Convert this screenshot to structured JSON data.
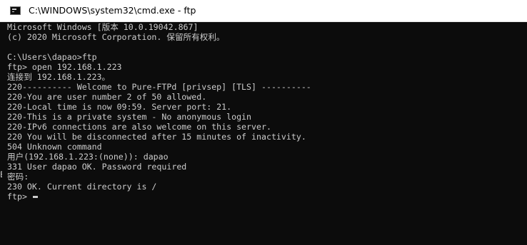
{
  "window": {
    "title": "C:\\WINDOWS\\system32\\cmd.exe - ftp",
    "icon": "cmd-icon"
  },
  "console": {
    "lines": [
      "Microsoft Windows [版本 10.0.19042.867]",
      "(c) 2020 Microsoft Corporation. 保留所有权利。",
      "",
      "C:\\Users\\dapao>ftp",
      "ftp> open 192.168.1.223",
      "连接到 192.168.1.223。",
      "220---------- Welcome to Pure-FTPd [privsep] [TLS] ----------",
      "220-You are user number 2 of 50 allowed.",
      "220-Local time is now 09:59. Server port: 21.",
      "220-This is a private system - No anonymous login",
      "220-IPv6 connections are also welcome on this server.",
      "220 You will be disconnected after 15 minutes of inactivity.",
      "504 Unknown command",
      "用户(192.168.1.223:(none)): dapao",
      "331 User dapao OK. Password required",
      "密码:",
      "230 OK. Current directory is /"
    ],
    "prompt": "ftp> ",
    "edge_fragment": "E"
  }
}
